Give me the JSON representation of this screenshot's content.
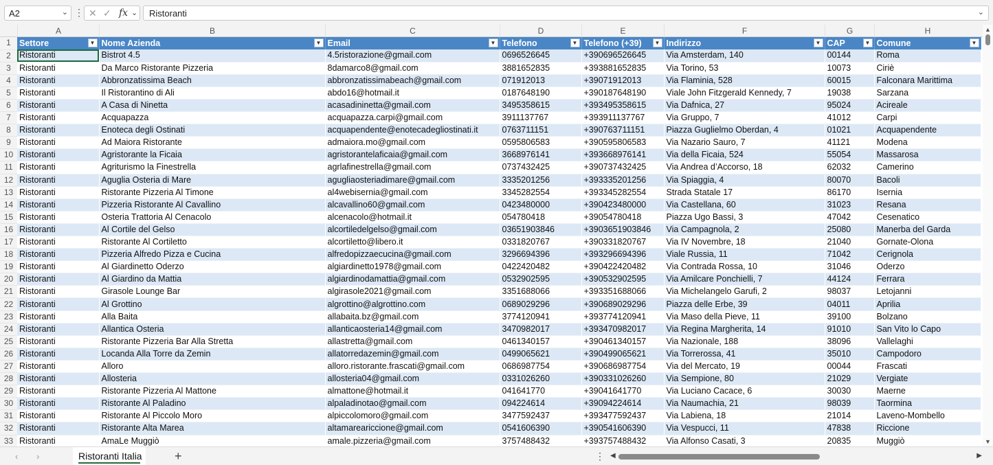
{
  "formula_bar": {
    "name_box": "A2",
    "fx_label": "fx",
    "cancel_glyph": "✕",
    "confirm_glyph": "✓",
    "content": "Ristoranti"
  },
  "column_letters": [
    "A",
    "B",
    "C",
    "D",
    "E",
    "F",
    "G",
    "H"
  ],
  "headers": [
    "Settore",
    "Nome Azienda",
    "Email",
    "Telefono",
    "Telefono (+39)",
    "Indirizzo",
    "CAP",
    "Comune"
  ],
  "rows": [
    [
      "Ristoranti",
      "Bistrot 4.5",
      "4.5ristorazione@gmail.com",
      "0696526645",
      "+390696526645",
      "Via Amsterdam, 140",
      "00144",
      "Roma"
    ],
    [
      "Ristoranti",
      "Da Marco Ristorante Pizzeria",
      "8damarco8@gmail.com",
      "3881652835",
      "+393881652835",
      "Via Torino, 53",
      "10073",
      "Ciriè"
    ],
    [
      "Ristoranti",
      "Abbronzatissima Beach",
      "abbronzatissimabeach@gmail.com",
      "071912013",
      "+39071912013",
      "Via Flaminia, 528",
      "60015",
      "Falconara Marittima"
    ],
    [
      "Ristoranti",
      "Il Ristorantino di Ali",
      "abdo16@hotmail.it",
      "0187648190",
      "+390187648190",
      "Viale John Fitzgerald Kennedy, 7",
      "19038",
      "Sarzana"
    ],
    [
      "Ristoranti",
      "A Casa di Ninetta",
      "acasadininetta@gmail.com",
      "3495358615",
      "+393495358615",
      "Via Dafnica, 27",
      "95024",
      "Acireale"
    ],
    [
      "Ristoranti",
      "Acquapazza",
      "acquapazza.carpi@gmail.com",
      "3911137767",
      "+393911137767",
      "Via Gruppo, 7",
      "41012",
      "Carpi"
    ],
    [
      "Ristoranti",
      "Enoteca degli Ostinati",
      "acquapendente@enotecadegliostinati.it",
      "0763711151",
      "+390763711151",
      "Piazza Guglielmo Oberdan, 4",
      "01021",
      "Acquapendente"
    ],
    [
      "Ristoranti",
      "Ad Maiora Ristorante",
      "admaiora.mo@gmail.com",
      "0595806583",
      "+390595806583",
      "Via Nazario Sauro, 7",
      "41121",
      "Modena"
    ],
    [
      "Ristoranti",
      "Agristorante la Ficaia",
      "agristorantelaficaia@gmail.com",
      "3668976141",
      "+393668976141",
      "Via della Ficaia, 524",
      "55054",
      "Massarosa"
    ],
    [
      "Ristoranti",
      "Agriturismo la Finestrella",
      "agrlafinestrella@gmail.com",
      "0737432425",
      "+390737432425",
      "Via Andrea d’Accorso, 18",
      "62032",
      "Camerino"
    ],
    [
      "Ristoranti",
      "Aguglia Osteria di Mare",
      "agugliaosteriadimare@gmail.com",
      "3335201256",
      "+393335201256",
      "Via Spiaggia, 4",
      "80070",
      "Bacoli"
    ],
    [
      "Ristoranti",
      "Ristorante Pizzeria Al Timone",
      "al4webisernia@gmail.com",
      "3345282554",
      "+393345282554",
      "Strada Statale 17",
      "86170",
      "Isernia"
    ],
    [
      "Ristoranti",
      "Pizzeria Ristorante Al Cavallino",
      "alcavallino60@gmail.com",
      "0423480000",
      "+390423480000",
      "Via Castellana, 60",
      "31023",
      "Resana"
    ],
    [
      "Ristoranti",
      "Osteria Trattoria Al Cenacolo",
      "alcenacolo@hotmail.it",
      "054780418",
      "+39054780418",
      "Piazza Ugo Bassi, 3",
      "47042",
      "Cesenatico"
    ],
    [
      "Ristoranti",
      "Al Cortile del Gelso",
      "alcortiledelgelso@gmail.com",
      "03651903846",
      "+3903651903846",
      "Via Campagnola, 2",
      "25080",
      "Manerba del Garda"
    ],
    [
      "Ristoranti",
      "Ristorante Al Cortiletto",
      "alcortiletto@libero.it",
      "0331820767",
      "+390331820767",
      "Via IV Novembre, 18",
      "21040",
      "Gornate-Olona"
    ],
    [
      "Ristoranti",
      "Pizzeria Alfredo Pizza e Cucina",
      "alfredopizzaecucina@gmail.com",
      "3296694396",
      "+393296694396",
      "Viale Russia, 11",
      "71042",
      "Cerignola"
    ],
    [
      "Ristoranti",
      "Al Giardinetto Oderzo",
      "algiardinetto1978@gmail.com",
      "0422420482",
      "+390422420482",
      "Via Contrada Rossa, 10",
      "31046",
      "Oderzo"
    ],
    [
      "Ristoranti",
      "Al Giardino da Mattia",
      "algiardinodamattia@gmail.com",
      "0532902595",
      "+390532902595",
      "Via Amilcare Ponchielli, 7",
      "44124",
      "Ferrara"
    ],
    [
      "Ristoranti",
      "Girasole Lounge Bar",
      "algirasole2021@gmail.com",
      "3351688066",
      "+393351688066",
      "Via Michelangelo Garufi, 2",
      "98037",
      "Letojanni"
    ],
    [
      "Ristoranti",
      "Al Grottino",
      "algrottino@algrottino.com",
      "0689029296",
      "+390689029296",
      "Piazza delle Erbe, 39",
      "04011",
      "Aprilia"
    ],
    [
      "Ristoranti",
      "Alla Baita",
      "allabaita.bz@gmail.com",
      "3774120941",
      "+393774120941",
      "Via Maso della Pieve, 11",
      "39100",
      "Bolzano"
    ],
    [
      "Ristoranti",
      "Allantica Osteria",
      "allanticaosteria14@gmail.com",
      "3470982017",
      "+393470982017",
      "Via Regina Margherita, 14",
      "91010",
      "San Vito lo Capo"
    ],
    [
      "Ristoranti",
      "Ristorante Pizzeria Bar Alla Stretta",
      "allastretta@gmail.com",
      "0461340157",
      "+390461340157",
      "Via Nazionale, 188",
      "38096",
      "Vallelaghi"
    ],
    [
      "Ristoranti",
      "Locanda Alla Torre da Zemin",
      "allatorredazemin@gmail.com",
      "0499065621",
      "+390499065621",
      "Via Torrerossa, 41",
      "35010",
      "Campodoro"
    ],
    [
      "Ristoranti",
      "Alloro",
      "alloro.ristorante.frascati@gmail.com",
      "0686987754",
      "+390686987754",
      "Via del Mercato, 19",
      "00044",
      "Frascati"
    ],
    [
      "Ristoranti",
      "Allosteria",
      "allosteria04@gmail.com",
      "0331026260",
      "+390331026260",
      "Via Sempione, 80",
      "21029",
      "Vergiate"
    ],
    [
      "Ristoranti",
      "Ristorante Pizzeria Al Mattone",
      "almattone@hotmail.it",
      "041641770",
      "+39041641770",
      "Via Luciano Cacace, 6",
      "30030",
      "Maerne"
    ],
    [
      "Ristoranti",
      "Ristorante Al Paladino",
      "alpaladinotao@gmail.com",
      "094224614",
      "+39094224614",
      "Via Naumachia, 21",
      "98039",
      "Taormina"
    ],
    [
      "Ristoranti",
      "Ristorante Al Piccolo Moro",
      "alpiccolomoro@gmail.com",
      "3477592437",
      "+393477592437",
      "Via Labiena, 18",
      "21014",
      "Laveno-Mombello"
    ],
    [
      "Ristoranti",
      "Ristorante Alta Marea",
      "altamareariccione@gmail.com",
      "0541606390",
      "+390541606390",
      "Via Vespucci, 11",
      "47838",
      "Riccione"
    ],
    [
      "Ristoranti",
      "AmaLe Muggiò",
      "amale.pizzeria@gmail.com",
      "3757488432",
      "+393757488432",
      "Via Alfonso Casati, 3",
      "20835",
      "Muggiò"
    ]
  ],
  "sheet_tabs": [
    "Ristoranti Italia"
  ],
  "tab_nav": {
    "prev": "‹",
    "next": "›",
    "add": "+",
    "more": "⋮"
  }
}
